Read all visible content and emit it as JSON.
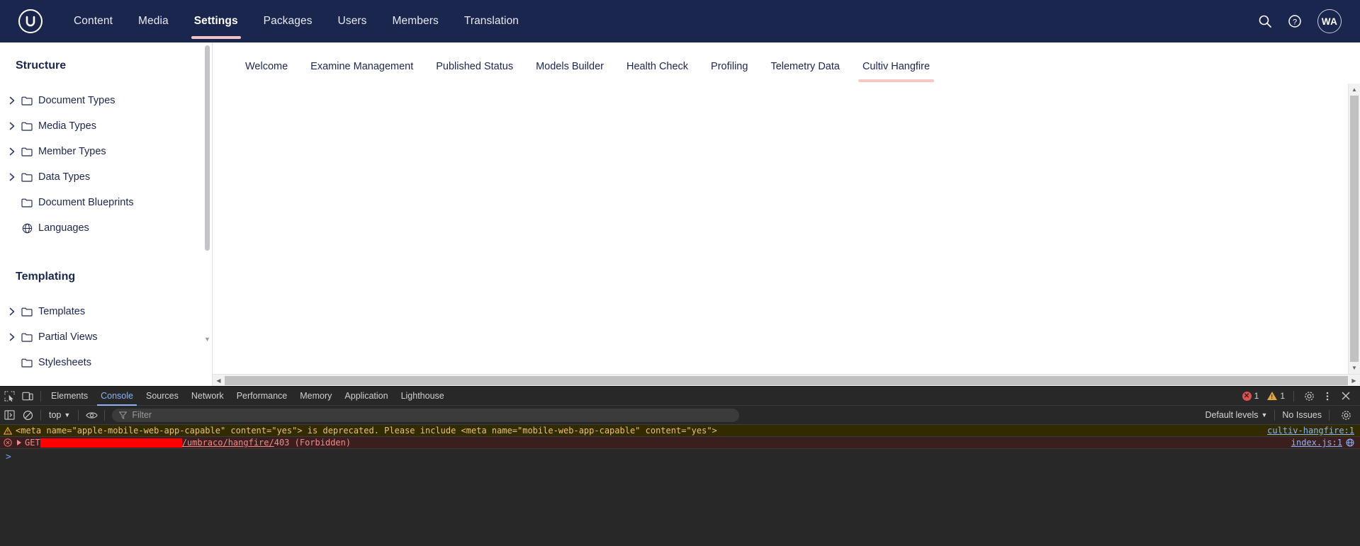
{
  "topnav": {
    "logo_name": "umbraco-logo",
    "items": [
      {
        "label": "Content",
        "active": false
      },
      {
        "label": "Media",
        "active": false
      },
      {
        "label": "Settings",
        "active": true
      },
      {
        "label": "Packages",
        "active": false
      },
      {
        "label": "Users",
        "active": false
      },
      {
        "label": "Members",
        "active": false
      },
      {
        "label": "Translation",
        "active": false
      }
    ],
    "search_icon": "search-icon",
    "help_icon": "help-icon",
    "avatar_initials": "WA"
  },
  "sidebar": {
    "sections": [
      {
        "title": "Structure",
        "items": [
          {
            "label": "Document Types",
            "icon": "folder-icon",
            "expandable": true
          },
          {
            "label": "Media Types",
            "icon": "folder-icon",
            "expandable": true
          },
          {
            "label": "Member Types",
            "icon": "folder-icon",
            "expandable": true
          },
          {
            "label": "Data Types",
            "icon": "folder-icon",
            "expandable": true
          },
          {
            "label": "Document Blueprints",
            "icon": "folder-icon",
            "expandable": false
          },
          {
            "label": "Languages",
            "icon": "globe-icon",
            "expandable": false
          }
        ]
      },
      {
        "title": "Templating",
        "items": [
          {
            "label": "Templates",
            "icon": "folder-icon",
            "expandable": true
          },
          {
            "label": "Partial Views",
            "icon": "folder-icon",
            "expandable": true
          },
          {
            "label": "Stylesheets",
            "icon": "folder-icon",
            "expandable": false
          }
        ]
      }
    ]
  },
  "main": {
    "tabs": [
      {
        "label": "Welcome",
        "active": false
      },
      {
        "label": "Examine Management",
        "active": false
      },
      {
        "label": "Published Status",
        "active": false
      },
      {
        "label": "Models Builder",
        "active": false
      },
      {
        "label": "Health Check",
        "active": false
      },
      {
        "label": "Profiling",
        "active": false
      },
      {
        "label": "Telemetry Data",
        "active": false
      },
      {
        "label": "Cultiv Hangfire",
        "active": true
      }
    ],
    "panel_content": ""
  },
  "devtools": {
    "tabs": [
      {
        "label": "Elements",
        "active": false
      },
      {
        "label": "Console",
        "active": true
      },
      {
        "label": "Sources",
        "active": false
      },
      {
        "label": "Network",
        "active": false
      },
      {
        "label": "Performance",
        "active": false
      },
      {
        "label": "Memory",
        "active": false
      },
      {
        "label": "Application",
        "active": false
      },
      {
        "label": "Lighthouse",
        "active": false
      }
    ],
    "inspect_icon": "inspect-element-icon",
    "device_icon": "device-toolbar-icon",
    "error_count": "1",
    "warning_count": "1",
    "settings_icon": "gear-icon",
    "more_icon": "kebab-menu-icon",
    "close_icon": "close-icon",
    "filterbar": {
      "sidebar_icon": "console-sidebar-icon",
      "clear_icon": "clear-console-icon",
      "context": "top",
      "eye_icon": "live-expression-icon",
      "filter_placeholder": "Filter",
      "filter_value": "",
      "levels": "Default levels",
      "issues": "No Issues",
      "settings_icon": "gear-icon"
    },
    "messages": [
      {
        "type": "warning",
        "icon": "warning-icon",
        "text": "<meta name=\"apple-mobile-web-app-capable\" content=\"yes\"> is deprecated. Please include <meta name=\"mobile-web-app-capable\" content=\"yes\">",
        "source": "cultiv-hangfire:1",
        "has_network_icon": false
      },
      {
        "type": "error",
        "icon": "error-icon",
        "method": "GET",
        "redacted_url": true,
        "url_path": "/umbraco/hangfire/",
        "status": " 403 (Forbidden)",
        "source": "index.js:1",
        "has_network_icon": true
      }
    ],
    "prompt": ">"
  }
}
